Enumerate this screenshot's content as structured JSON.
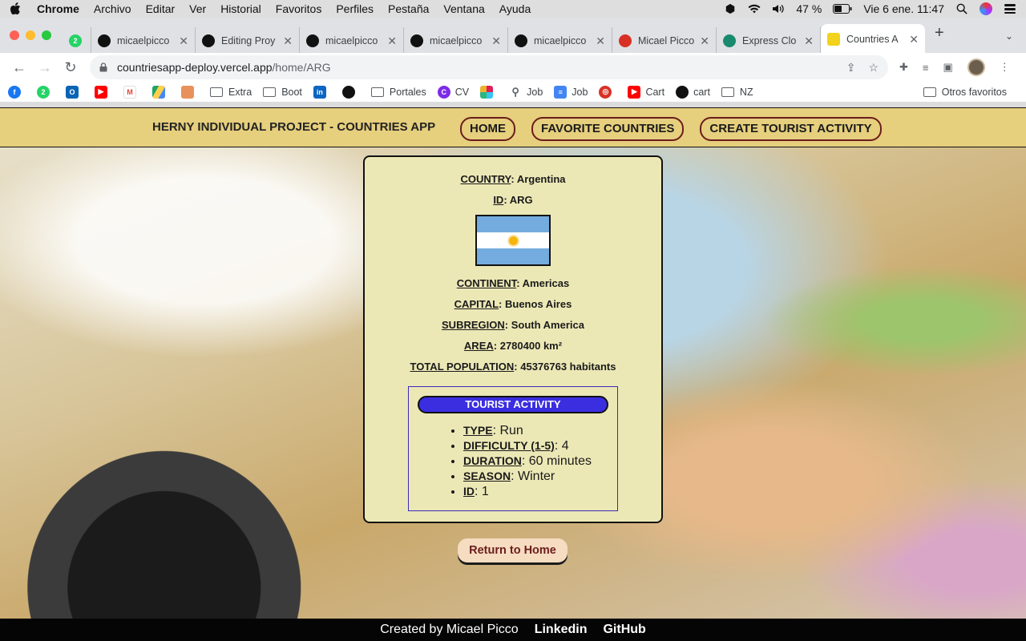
{
  "menubar": {
    "app": "Chrome",
    "items": [
      "Archivo",
      "Editar",
      "Ver",
      "Historial",
      "Favoritos",
      "Perfiles",
      "Pestaña",
      "Ventana",
      "Ayuda"
    ],
    "battery": "47 %",
    "datetime": "Vie 6 ene.  11:47"
  },
  "tabs": [
    {
      "label": "micaelpicco",
      "icon": "github-icon"
    },
    {
      "label": "Editing Proy",
      "icon": "github-icon"
    },
    {
      "label": "micaelpicco",
      "icon": "github-icon"
    },
    {
      "label": "micaelpicco",
      "icon": "github-icon"
    },
    {
      "label": "micaelpicco",
      "icon": "github-icon"
    },
    {
      "label": "Micael Picco",
      "icon": "target-icon"
    },
    {
      "label": "Express Clo",
      "icon": "express-icon"
    },
    {
      "label": "Countries A",
      "icon": "app-icon",
      "active": true
    }
  ],
  "tab_badge": "2",
  "address": {
    "host": "countriesapp-deploy.vercel.app",
    "path": "/home/ARG"
  },
  "bookmarks": [
    {
      "label": "",
      "icon": "facebook-icon",
      "color": "#1877f2"
    },
    {
      "label": "",
      "icon": "whatsapp-icon",
      "color": "#25d366",
      "badge": "2"
    },
    {
      "label": "",
      "icon": "outlook-icon",
      "color": "#0a64b5"
    },
    {
      "label": "",
      "icon": "youtube-icon",
      "color": "#ff0000"
    },
    {
      "label": "",
      "icon": "gmail-icon",
      "color": "#ea4335"
    },
    {
      "label": "",
      "icon": "drive-icon",
      "color": "#1fa463"
    },
    {
      "label": "",
      "icon": "cube-icon",
      "color": "#e8915a"
    },
    {
      "label": "Extra",
      "icon": "folder-icon"
    },
    {
      "label": "Boot",
      "icon": "folder-icon"
    },
    {
      "label": "",
      "icon": "linkedin-icon",
      "color": "#0a66c2"
    },
    {
      "label": "",
      "icon": "github-icon",
      "color": "#111111"
    },
    {
      "label": "Portales",
      "icon": "folder-icon"
    },
    {
      "label": "CV",
      "icon": "canva-icon",
      "color": "#7d2ae8"
    },
    {
      "label": "",
      "icon": "slack-icon",
      "color": "#e01e5a"
    },
    {
      "label": "Job",
      "icon": "search-icon",
      "color": "#5f6368"
    },
    {
      "label": "Job",
      "icon": "docs-icon",
      "color": "#4285f4"
    },
    {
      "label": "",
      "icon": "target-icon",
      "color": "#d93025"
    },
    {
      "label": "Cart",
      "icon": "youtube-icon",
      "color": "#ff0000"
    },
    {
      "label": "cart",
      "icon": "github-icon",
      "color": "#111111"
    },
    {
      "label": "NZ",
      "icon": "folder-icon"
    }
  ],
  "bookmarks_other": "Otros favoritos",
  "app": {
    "brand": "HERNY INDIVIDUAL PROJECT - COUNTRIES APP",
    "nav": {
      "home": "HOME",
      "favorites": "FAVORITE COUNTRIES",
      "create": "CREATE TOURIST ACTIVITY"
    },
    "country": {
      "country_label": "COUNTRY",
      "country": "Argentina",
      "id_label": "ID",
      "id": "ARG",
      "continent_label": "CONTINENT",
      "continent": "Americas",
      "capital_label": "CAPITAL",
      "capital": "Buenos Aires",
      "subregion_label": "SUBREGION",
      "subregion": "South America",
      "area_label": "AREA",
      "area": "2780400 km²",
      "population_label": "TOTAL POPULATION",
      "population": "45376763 habitants"
    },
    "flag_colors": {
      "sky": "#74acdf",
      "white": "#ffffff",
      "sun": "#f6b40e"
    },
    "activity": {
      "title": "TOURIST ACTIVITY",
      "type_label": "TYPE",
      "type": "Run",
      "difficulty_label": "DIFFICULTY (1-5)",
      "difficulty": "4",
      "duration_label": "DURATION",
      "duration": "60 minutes",
      "season_label": "SEASON",
      "season": "Winter",
      "id_label": "ID",
      "id": "1"
    },
    "return_label": "Return to Home",
    "footer": {
      "credit": "Created by Micael Picco",
      "linkedin": "Linkedin",
      "github": "GitHub"
    }
  }
}
